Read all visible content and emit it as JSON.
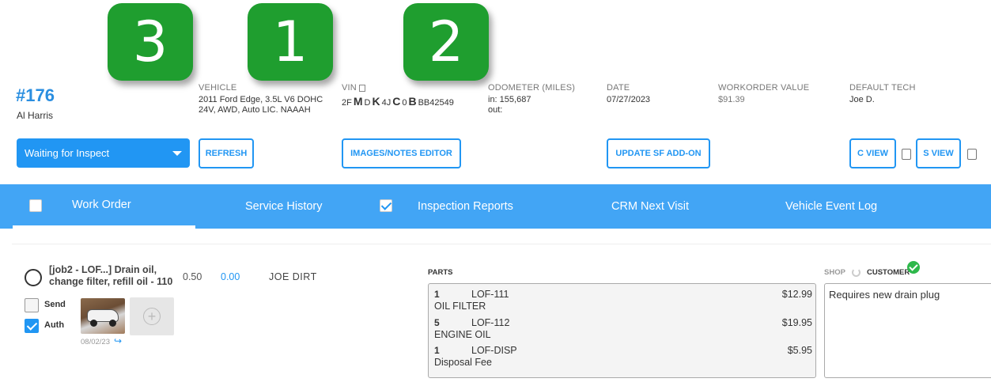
{
  "badges": [
    "3",
    "1",
    "2"
  ],
  "workorder": {
    "number": "#176",
    "customer": "Al Harris"
  },
  "vehicle": {
    "label": "VEHICLE",
    "line1": "2011 Ford Edge, 3.5L V6 DOHC",
    "line2": "24V, AWD, Auto LIC. NAAAH"
  },
  "vin": {
    "label": "VIN",
    "parts": [
      {
        "t": "2F",
        "big": false
      },
      {
        "t": "M",
        "big": true
      },
      {
        "t": "D",
        "big": false
      },
      {
        "t": "K",
        "big": true
      },
      {
        "t": "4J",
        "big": false
      },
      {
        "t": "C",
        "big": true
      },
      {
        "t": "0",
        "big": false
      },
      {
        "t": "B",
        "big": true
      },
      {
        "t": "BB42549",
        "big": false
      }
    ]
  },
  "odometer": {
    "label": "ODOMETER (MILES)",
    "in": "in: 155,687",
    "out": "out:"
  },
  "date": {
    "label": "DATE",
    "value": "07/27/2023"
  },
  "wo_value": {
    "label": "WORKORDER VALUE",
    "value": "$91.39"
  },
  "tech": {
    "label": "DEFAULT TECH",
    "value": "Joe D."
  },
  "status": {
    "selected": "Waiting for Inspect"
  },
  "buttons": {
    "refresh": "REFRESH",
    "images_notes": "IMAGES/NOTES EDITOR",
    "update_sf": "UPDATE SF ADD-ON",
    "c_view": "C VIEW",
    "s_view": "S VIEW"
  },
  "tabs": {
    "work_order": "Work Order",
    "service_history": "Service History",
    "inspection_reports": "Inspection Reports",
    "crm_next_visit": "CRM Next Visit",
    "vehicle_event_log": "Vehicle Event Log"
  },
  "job": {
    "title": "[job2 - LOF...] Drain oil, change filter, refill oil - 110",
    "hours": "0.50",
    "price": "0.00",
    "tech": "JOE DIRT",
    "send_label": "Send",
    "auth_label": "Auth",
    "image_date": "08/02/23"
  },
  "parts": {
    "label": "PARTS",
    "items": [
      {
        "qty": "1",
        "pn": "LOF-111",
        "amount": "$12.99",
        "desc": "OIL FILTER"
      },
      {
        "qty": "5",
        "pn": "LOF-112",
        "amount": "$19.95",
        "desc": "ENGINE OIL"
      },
      {
        "qty": "1",
        "pn": "LOF-DISP",
        "amount": "$5.95",
        "desc": "Disposal Fee"
      }
    ]
  },
  "notes": {
    "shop_label": "SHOP",
    "customer_label": "CUSTOMER",
    "text": "Requires new drain plug"
  },
  "colors": {
    "accent": "#2196f3",
    "tabbar": "#42a5f5",
    "badge": "#1f9e2f",
    "check": "#2eb84b"
  }
}
